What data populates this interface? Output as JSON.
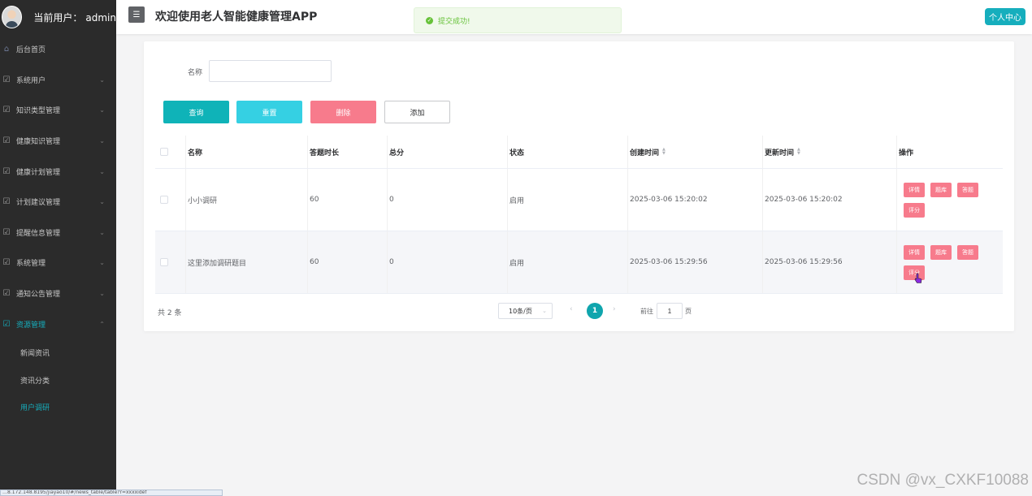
{
  "sidebar": {
    "user_label": "当前用户：",
    "username": "admin",
    "menu": [
      {
        "label": "后台首页",
        "icon": "home-icon"
      },
      {
        "label": "系统用户",
        "icon": "edit-icon"
      },
      {
        "label": "知识类型管理",
        "icon": "edit-icon"
      },
      {
        "label": "健康知识管理",
        "icon": "edit-icon"
      },
      {
        "label": "健康计划管理",
        "icon": "edit-icon"
      },
      {
        "label": "计划建议管理",
        "icon": "edit-icon"
      },
      {
        "label": "提醒信息管理",
        "icon": "edit-icon"
      },
      {
        "label": "系统管理",
        "icon": "edit-icon"
      },
      {
        "label": "通知公告管理",
        "icon": "edit-icon"
      },
      {
        "label": "资源管理",
        "icon": "edit-icon"
      }
    ],
    "submenu": [
      "新闻资讯",
      "资讯分类",
      "用户调研"
    ]
  },
  "header": {
    "menu_toggle": "☰",
    "title": "欢迎使用老人智能健康管理APP",
    "toast": "提交成功!",
    "profile_button": "个人中心"
  },
  "search": {
    "label": "名称",
    "value": ""
  },
  "buttons": {
    "query": "查询",
    "reset": "重置",
    "delete": "删除",
    "add": "添加"
  },
  "table": {
    "columns": [
      "名称",
      "答题时长",
      "总分",
      "状态",
      "创建时间",
      "更新时间",
      "操作"
    ],
    "rows": [
      {
        "name": "小小调研",
        "duration": "60",
        "score": "0",
        "status": "启用",
        "created": "2025-03-06 15:20:02",
        "updated": "2025-03-06 15:20:02"
      },
      {
        "name": "这里添加调研题目",
        "duration": "60",
        "score": "0",
        "status": "启用",
        "created": "2025-03-06 15:29:56",
        "updated": "2025-03-06 15:29:56"
      }
    ],
    "row_actions": [
      "详情",
      "题库",
      "答题",
      "评分"
    ]
  },
  "pagination": {
    "total": "共 2 条",
    "page_size": "10条/页",
    "current_page": "1",
    "goto_label": "前往",
    "goto_value": "1",
    "goto_unit": "页"
  },
  "status_url": "…8.172.148.8195/jiayao10/#/news_table/table?r=xxxxidef",
  "watermark": "CSDN @vx_CXKF10088",
  "colors": {
    "sidebar_bg": "#2b2b2b",
    "accent": "#16aebd",
    "danger": "#f77b8c",
    "success": "#67c23a"
  }
}
